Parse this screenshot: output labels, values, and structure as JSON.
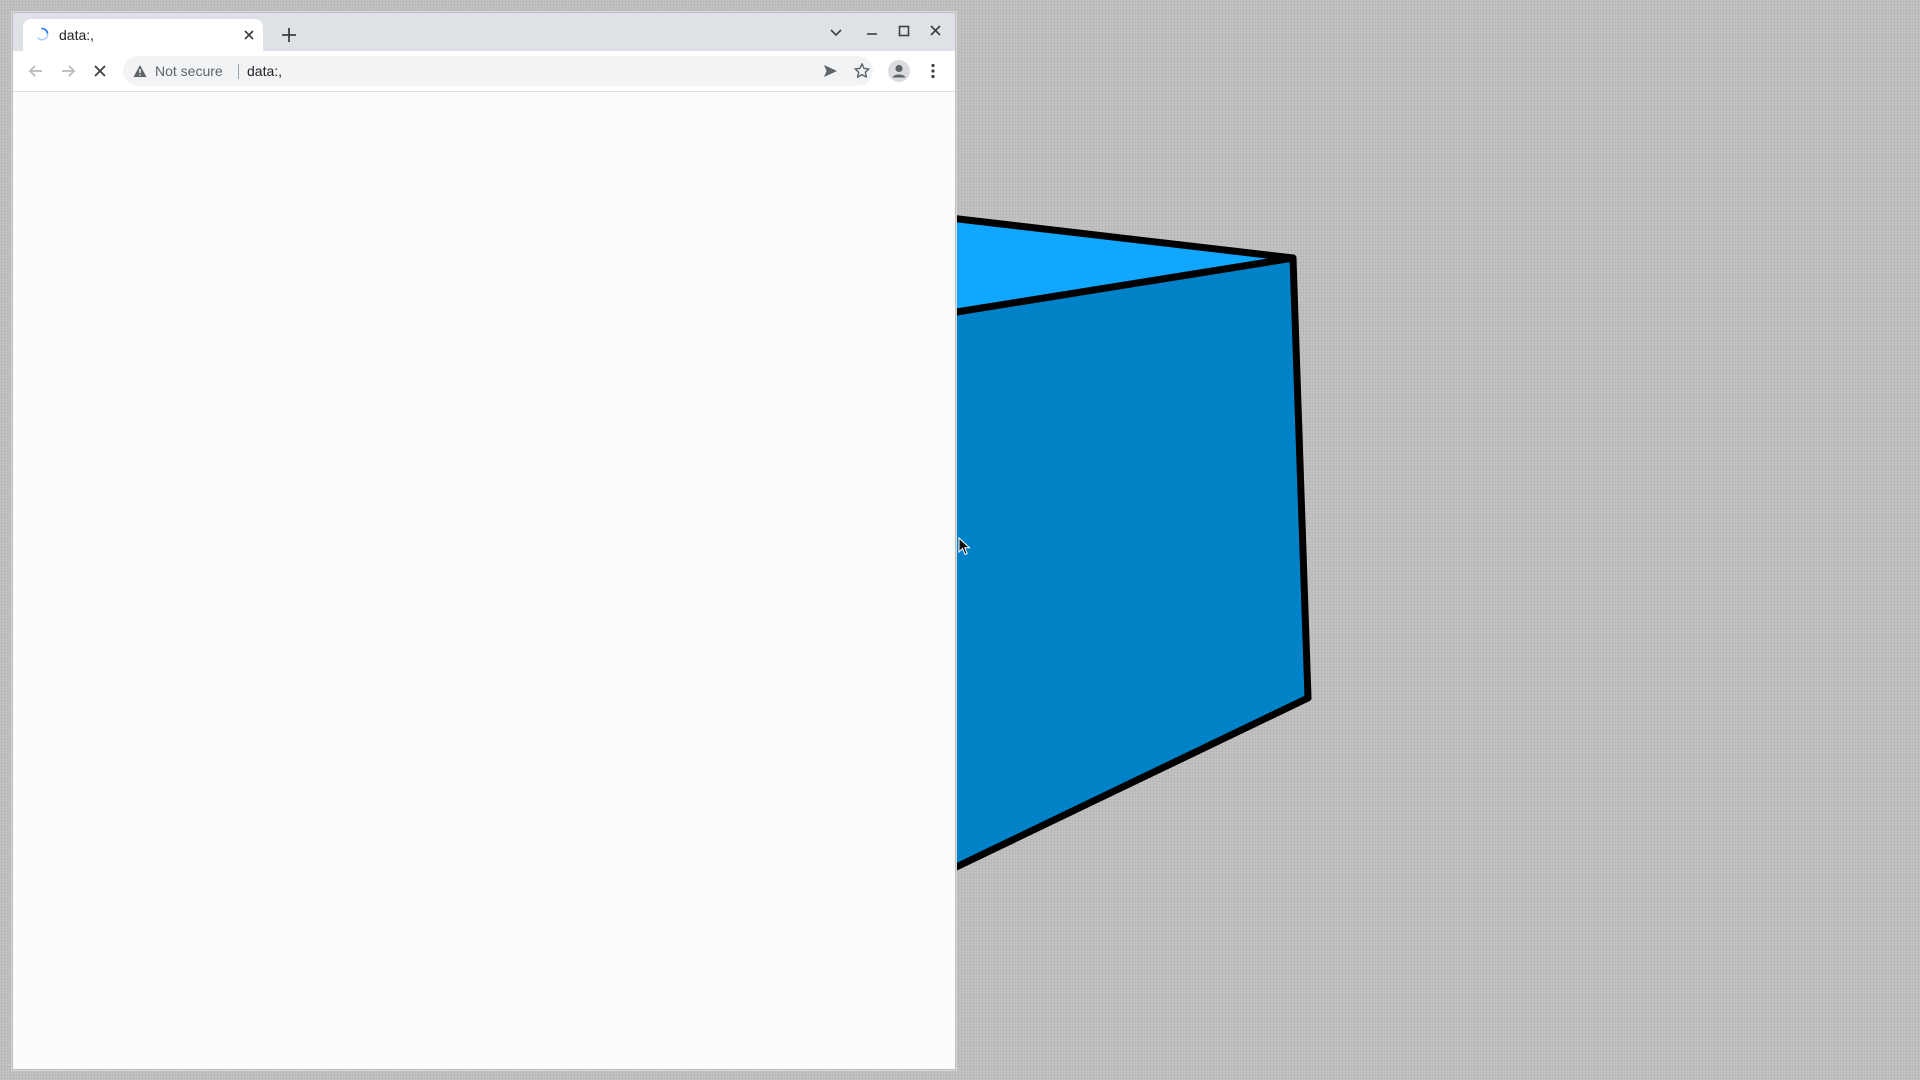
{
  "browser": {
    "tab": {
      "title": "data:,"
    },
    "address_bar": {
      "security_label": "Not secure",
      "url": "data:,"
    }
  },
  "desktop": {
    "shape": {
      "top_face_color": "#11a7ff",
      "front_face_color": "#0082c8",
      "outline_color": "#000000"
    },
    "background_color": "#c2c2c2"
  }
}
